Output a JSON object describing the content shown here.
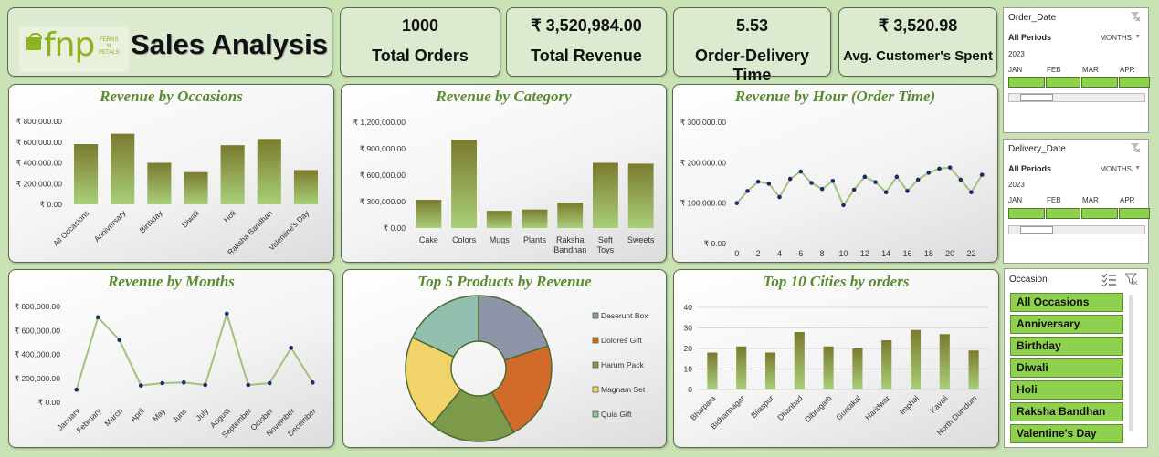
{
  "header": {
    "logo_main": "fnp",
    "logo_small": [
      "FERNS",
      "N",
      "PETALS"
    ],
    "title": "Sales Analysis"
  },
  "kpis": [
    {
      "value": "1000",
      "label": "Total Orders"
    },
    {
      "value": "₹ 3,520,984.00",
      "label": "Total Revenue"
    },
    {
      "value": "5.53",
      "label": "Order-Delivery Time"
    },
    {
      "value": "₹ 3,520.98",
      "label": "Avg. Customer's Spent"
    }
  ],
  "colors": {
    "bar_dark": "#7b7a2e",
    "bar_light": "#a8cf79",
    "line": "#a3c27a",
    "marker": "#1c2a6a",
    "title": "#5a8a32"
  },
  "chart_data": [
    {
      "id": "occasions",
      "type": "bar",
      "title": "Revenue by Occasions",
      "categories": [
        "All Occasions",
        "Anniversary",
        "Birthday",
        "Diwali",
        "Holi",
        "Raksha Bandhan",
        "Valentine's Day"
      ],
      "values": [
        580000,
        680000,
        400000,
        310000,
        570000,
        630000,
        330000
      ],
      "yticks": [
        "₹ 0.00",
        "₹ 200,000.00",
        "₹ 400,000.00",
        "₹ 600,000.00",
        "₹ 800,000.00"
      ],
      "ylim": [
        0,
        800000
      ]
    },
    {
      "id": "category",
      "type": "bar",
      "title": "Revenue by Category",
      "categories": [
        "Cake",
        "Colors",
        "Mugs",
        "Plants",
        "Raksha Bandhan",
        "Soft Toys",
        "Sweets"
      ],
      "values": [
        320000,
        1000000,
        195000,
        210000,
        290000,
        740000,
        730000
      ],
      "yticks": [
        "₹ 0.00",
        "₹ 300,000.00",
        "₹ 600,000.00",
        "₹ 900,000.00",
        "₹ 1,200,000.00"
      ],
      "ylim": [
        0,
        1200000
      ]
    },
    {
      "id": "hour",
      "type": "line",
      "title": "Revenue by Hour (Order Time)",
      "x": [
        0,
        1,
        2,
        3,
        4,
        5,
        6,
        7,
        8,
        9,
        10,
        11,
        12,
        13,
        14,
        15,
        16,
        17,
        18,
        19,
        20,
        21,
        22,
        23
      ],
      "values": [
        100000,
        130000,
        153000,
        148000,
        115000,
        160000,
        178000,
        150000,
        135000,
        155000,
        95000,
        133000,
        165000,
        152000,
        127000,
        165000,
        130000,
        158000,
        175000,
        185000,
        188000,
        158000,
        127000,
        170000
      ],
      "xticks": [
        "0",
        "2",
        "4",
        "6",
        "8",
        "10",
        "12",
        "14",
        "16",
        "18",
        "20",
        "22"
      ],
      "yticks": [
        "₹ 0.00",
        "₹ 100,000.00",
        "₹ 200,000.00",
        "₹ 300,000.00"
      ],
      "ylim": [
        0,
        300000
      ]
    },
    {
      "id": "months",
      "type": "line",
      "title": "Revenue by Months",
      "categories": [
        "January",
        "February",
        "March",
        "April",
        "May",
        "June",
        "July",
        "August",
        "September",
        "October",
        "November",
        "December"
      ],
      "values": [
        105000,
        710000,
        520000,
        140000,
        160000,
        165000,
        145000,
        740000,
        145000,
        160000,
        455000,
        165000
      ],
      "yticks": [
        "₹ 0.00",
        "₹ 200,000.00",
        "₹ 400,000.00",
        "₹ 600,000.00",
        "₹ 800,000.00"
      ],
      "ylim": [
        0,
        800000
      ]
    },
    {
      "id": "products",
      "type": "pie",
      "title": "Top 5 Products by Revenue",
      "categories": [
        "Deserunt Box",
        "Dolores Gift",
        "Harum Pack",
        "Magnam Set",
        "Quia Gift"
      ],
      "values": [
        20,
        22,
        19,
        21,
        18
      ],
      "colors": [
        "#8e95a8",
        "#d26a2a",
        "#7c9a4a",
        "#f2d36a",
        "#93bfae"
      ]
    },
    {
      "id": "cities",
      "type": "bar",
      "title": "Top 10 Cities by orders",
      "categories": [
        "Bhatpara",
        "Bidhannagar",
        "Bilaspur",
        "Dhanbad",
        "Dibrugarh",
        "Guntakal",
        "Haridwar",
        "Imphal",
        "Kavali",
        "North Dumdum"
      ],
      "values": [
        18,
        21,
        18,
        28,
        21,
        20,
        24,
        29,
        27,
        19
      ],
      "yticks": [
        "0",
        "10",
        "20",
        "30",
        "40"
      ],
      "ylim": [
        0,
        40
      ]
    }
  ],
  "slicers": {
    "order_date": {
      "header": "Order_Date",
      "periods": "All Periods",
      "unit": "MONTHS",
      "year": "2023",
      "months": [
        "JAN",
        "FEB",
        "MAR",
        "APR"
      ]
    },
    "delivery_date": {
      "header": "Delivery_Date",
      "periods": "All Periods",
      "unit": "MONTHS",
      "year": "2023",
      "months": [
        "JAN",
        "FEB",
        "MAR",
        "APR"
      ]
    },
    "occasion": {
      "header": "Occasion",
      "items": [
        "All Occasions",
        "Anniversary",
        "Birthday",
        "Diwali",
        "Holi",
        "Raksha Bandhan",
        "Valentine's Day"
      ]
    }
  }
}
